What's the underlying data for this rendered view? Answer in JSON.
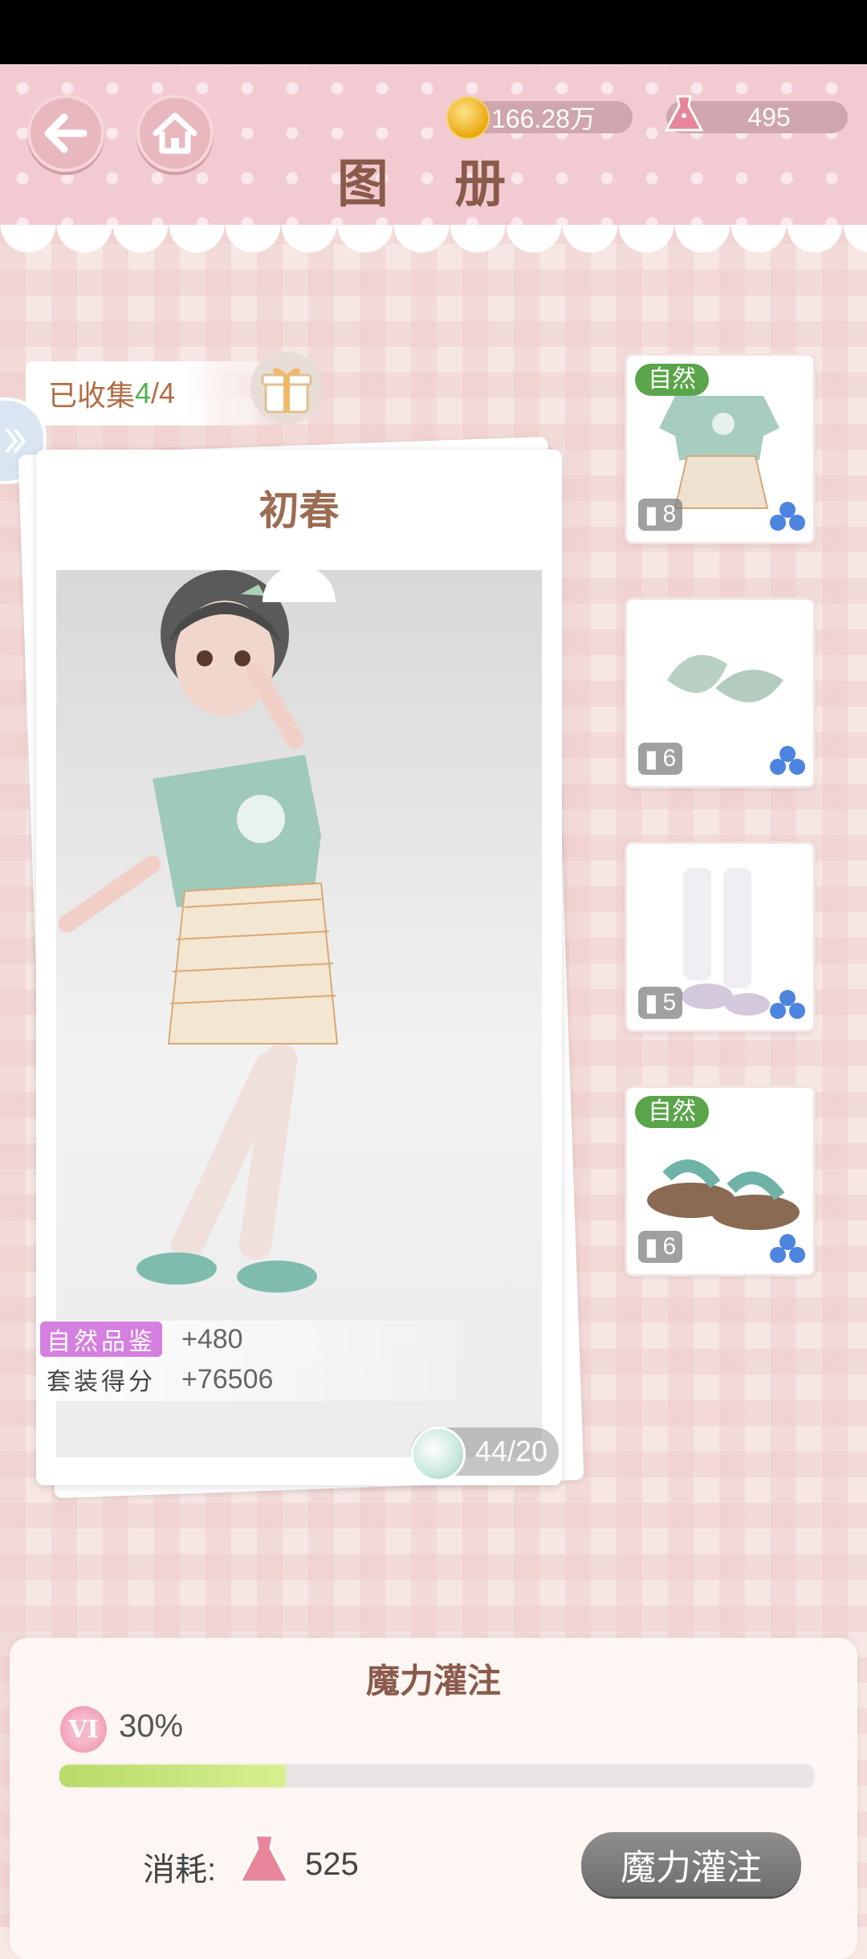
{
  "header": {
    "title": "图 册",
    "coins": "166.28万",
    "dress_currency": "495",
    "back_icon": "back-arrow-icon",
    "home_icon": "home-icon"
  },
  "collection": {
    "prefix": "已收集",
    "collected": "4",
    "total": "/4"
  },
  "suit": {
    "name": "初春",
    "stat1_label": "自然品鉴",
    "stat1_value": "+480",
    "stat2_label": "套装得分",
    "stat2_value": "+76506",
    "score": "44/20"
  },
  "items": [
    {
      "tag": "自然",
      "count": "8",
      "icon": "outfit-top-skirt-icon"
    },
    {
      "tag": "",
      "count": "6",
      "icon": "leaf-accessory-icon"
    },
    {
      "tag": "",
      "count": "5",
      "icon": "socks-icon"
    },
    {
      "tag": "自然",
      "count": "6",
      "icon": "sandals-icon"
    }
  ],
  "magic": {
    "title": "魔力灌注",
    "level": "VI",
    "percent": "30%",
    "progress": 0.3,
    "cost_label": "消耗:",
    "cost_value": "525",
    "button": "魔力灌注"
  },
  "colors": {
    "accent_green": "#4fb34f",
    "tag_green": "#5aa54a",
    "title_brown": "#8a5a4a"
  }
}
